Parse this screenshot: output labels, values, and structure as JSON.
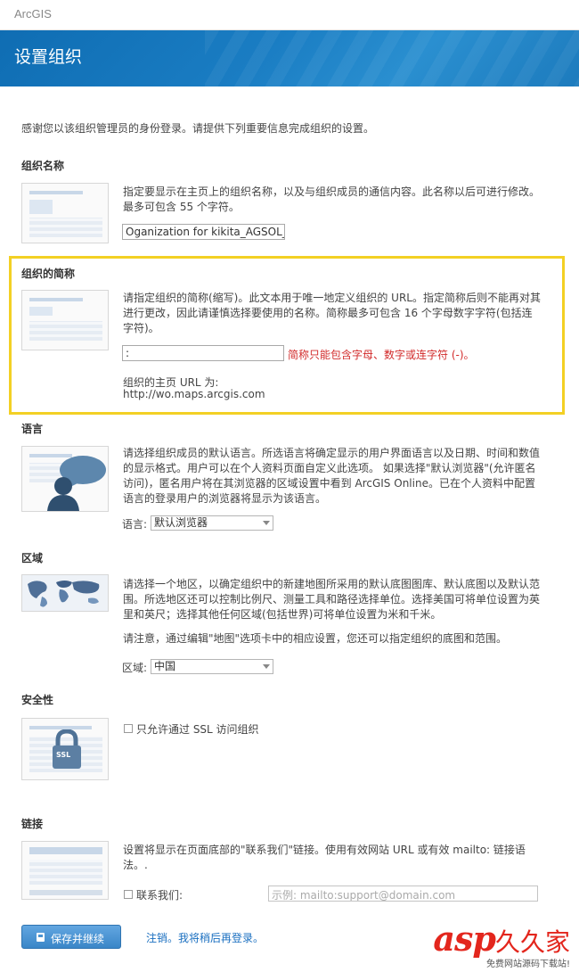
{
  "app": {
    "brand": "ArcGIS"
  },
  "page": {
    "title": "设置组织",
    "intro": "感谢您以该组织管理员的身份登录。请提供下列重要信息完成组织的设置。"
  },
  "org_name": {
    "heading": "组织名称",
    "desc_lines": [
      "指定要显示在主页上的组织名称，以及与组织成员的通信内容。此名称以后可进行修改。",
      "最多可包含 55 个字符。"
    ],
    "value": "Oganization for kikita_AGSOL_"
  },
  "short_name": {
    "heading": "组织的简称",
    "desc_lines": [
      "请指定组织的简称(缩写)。此文本用于唯一地定义组织的 URL。指定简称后则不能再对其",
      "进行更改，因此请谨慎选择要使用的名称。简称最多可包含 16 个字母数字字符(包括连",
      "字符)。"
    ],
    "value": ":",
    "error": "简称只能包含字母、数字或连字符 (-)。",
    "url_label": "组织的主页 URL 为:",
    "url_value": "http://wo.maps.arcgis.com"
  },
  "language": {
    "heading": "语言",
    "desc_lines": [
      "请选择组织成员的默认语言。所选语言将确定显示的用户界面语言以及日期、时间和数值",
      "的显示格式。用户可以在个人资料页面自定义此选项。 如果选择\"默认浏览器\"(允许匿名",
      "访问)，匿名用户将在其浏览器的区域设置中看到 ArcGIS Online。已在个人资料中配置",
      "语言的登录用户的浏览器将显示为该语言。"
    ],
    "label": "语言:",
    "selected": "默认浏览器"
  },
  "region": {
    "heading": "区域",
    "desc_lines": [
      "请选择一个地区，以确定组织中的新建地图所采用的默认底图图库、默认底图以及默认范",
      "围。所选地区还可以控制比例尺、测量工具和路径选择单位。选择美国可将单位设置为英",
      "里和英尺；选择其他任何区域(包括世界)可将单位设置为米和千米。"
    ],
    "note": "请注意，通过编辑\"地图\"选项卡中的相应设置，您还可以指定组织的底图和范围。",
    "label": "区域:",
    "selected": "中国"
  },
  "security": {
    "heading": "安全性",
    "ssl_label": "只允许通过 SSL 访问组织",
    "thumb_text": "SSL"
  },
  "links": {
    "heading": "链接",
    "desc_lines": [
      "设置将显示在页面底部的\"联系我们\"链接。使用有效网站 URL 或有效 mailto: 链接语",
      "法。."
    ],
    "contact_label": "联系我们:",
    "contact_placeholder": "示例: mailto:support@domain.com"
  },
  "actions": {
    "save_label": "保存并继续",
    "signout_label": "注销。我将稍后再登录。"
  },
  "watermark": {
    "main": "asp",
    "cn": "久久家",
    "sub": "免费网站源码下载站!"
  },
  "colors": {
    "banner": "#1a7dc3",
    "highlight": "#f3d024",
    "error": "#d22b2b",
    "link": "#1a6fc0"
  }
}
